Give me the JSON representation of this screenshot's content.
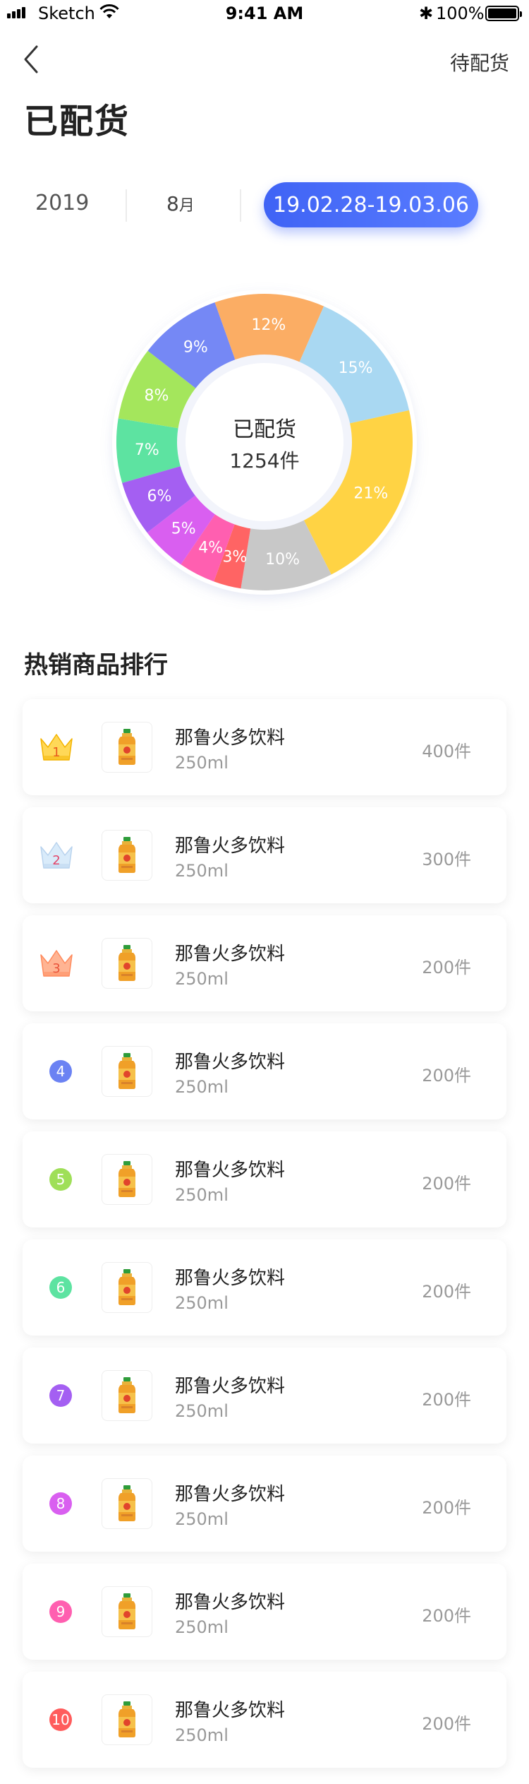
{
  "status_bar": {
    "carrier": "Sketch",
    "time": "9:41 AM",
    "battery": "100%"
  },
  "nav": {
    "right_label": "待配货"
  },
  "page": {
    "title": "已配货"
  },
  "filters": {
    "year": "2019",
    "month": "8",
    "month_unit": "月",
    "range": "19.02.28-19.03.06"
  },
  "chart_data": {
    "type": "pie",
    "center_title": "已配货",
    "center_count": "1254件",
    "slices": [
      {
        "label": "7%",
        "value": 7,
        "color": "#5de3a1"
      },
      {
        "label": "8%",
        "value": 8,
        "color": "#a4e65c"
      },
      {
        "label": "9%",
        "value": 9,
        "color": "#7588f5"
      },
      {
        "label": "12%",
        "value": 12,
        "color": "#fbad64"
      },
      {
        "label": "15%",
        "value": 15,
        "color": "#a9d8f2"
      },
      {
        "label": "21%",
        "value": 21,
        "color": "#ffd344"
      },
      {
        "label": "10%",
        "value": 10,
        "color": "#c8c8c8"
      },
      {
        "label": "3%",
        "value": 3,
        "color": "#ff6464"
      },
      {
        "label": "4%",
        "value": 4,
        "color": "#ff5fb0"
      },
      {
        "label": "5%",
        "value": 5,
        "color": "#d95ff0"
      },
      {
        "label": "6%",
        "value": 6,
        "color": "#a45ff2"
      }
    ]
  },
  "ranking": {
    "title": "热销商品排行",
    "items": [
      {
        "rank": "1",
        "name": "那鲁火多饮料",
        "spec": "250ml",
        "count": "400件",
        "badge": "crown-gold"
      },
      {
        "rank": "2",
        "name": "那鲁火多饮料",
        "spec": "250ml",
        "count": "300件",
        "badge": "crown-silver"
      },
      {
        "rank": "3",
        "name": "那鲁火多饮料",
        "spec": "250ml",
        "count": "200件",
        "badge": "crown-bronze"
      },
      {
        "rank": "4",
        "name": "那鲁火多饮料",
        "spec": "250ml",
        "count": "200件",
        "badge": "circle",
        "color": "#6b82f3"
      },
      {
        "rank": "5",
        "name": "那鲁火多饮料",
        "spec": "250ml",
        "count": "200件",
        "badge": "circle",
        "color": "#9fdf58"
      },
      {
        "rank": "6",
        "name": "那鲁火多饮料",
        "spec": "250ml",
        "count": "200件",
        "badge": "circle",
        "color": "#5de3a1"
      },
      {
        "rank": "7",
        "name": "那鲁火多饮料",
        "spec": "250ml",
        "count": "200件",
        "badge": "circle",
        "color": "#a45ff2"
      },
      {
        "rank": "8",
        "name": "那鲁火多饮料",
        "spec": "250ml",
        "count": "200件",
        "badge": "circle",
        "color": "#d95ff0"
      },
      {
        "rank": "9",
        "name": "那鲁火多饮料",
        "spec": "250ml",
        "count": "200件",
        "badge": "circle",
        "color": "#ff5fb0"
      },
      {
        "rank": "10",
        "name": "那鲁火多饮料",
        "spec": "250ml",
        "count": "200件",
        "badge": "circle",
        "color": "#ff5c5c"
      }
    ]
  }
}
